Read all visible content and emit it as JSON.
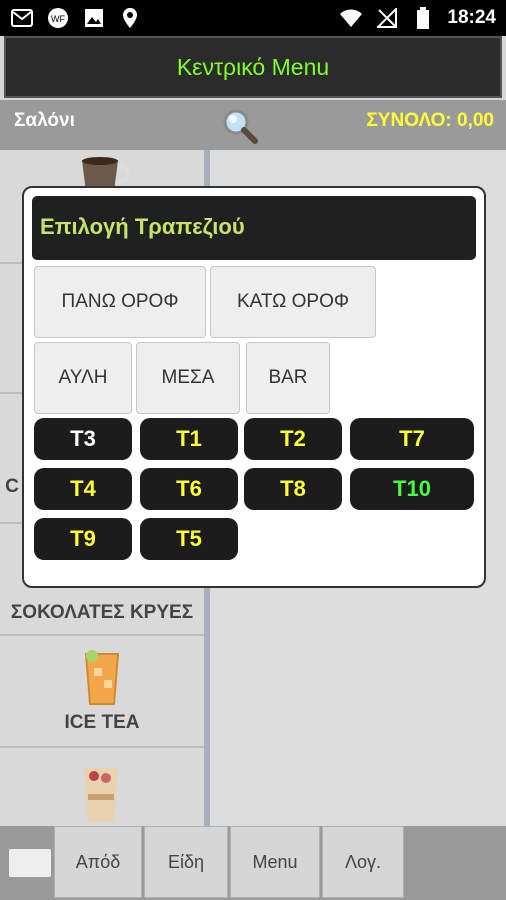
{
  "status_bar": {
    "time": "18:24",
    "icons_left": [
      "gmail-icon",
      "wifi-calling-icon",
      "image-icon",
      "location-icon"
    ],
    "icons_right": [
      "wifi-icon",
      "no-signal-icon",
      "battery-icon"
    ]
  },
  "header": {
    "title": "Κεντρικό Menu"
  },
  "subbar": {
    "room": "Σαλόνι",
    "total": "ΣΥΝΟΛΟ: 0,00"
  },
  "categories": [
    {
      "label": ""
    },
    {
      "label": "C"
    },
    {
      "label": ""
    },
    {
      "label": "ΣΟΚΟΛΑΤΕΣ ΚΡΥΕΣ"
    },
    {
      "label": "ICE TEA"
    },
    {
      "label": ""
    }
  ],
  "bottom_nav": [
    "Απόδ",
    "Είδη",
    "Menu",
    "Λογ."
  ],
  "dialog": {
    "title": "Επιλογή Τραπεζιού",
    "floors": [
      "ΠΑΝΩ ΟΡΟΦ",
      "ΚΑΤΩ ΟΡΟΦ"
    ],
    "areas": [
      "ΑΥΛΗ",
      "ΜΕΣΑ",
      "BAR"
    ],
    "tables": [
      {
        "label": "T3",
        "color": "#ffffff"
      },
      {
        "label": "T1",
        "color": "#ffff33"
      },
      {
        "label": "T2",
        "color": "#ffff33"
      },
      {
        "label": "T7",
        "color": "#ffff33"
      },
      {
        "label": "T4",
        "color": "#ffff33"
      },
      {
        "label": "T6",
        "color": "#ffff33"
      },
      {
        "label": "T8",
        "color": "#ffff33"
      },
      {
        "label": "T10",
        "color": "#44ff44"
      },
      {
        "label": "T9",
        "color": "#ffff33"
      },
      {
        "label": "T5",
        "color": "#ffff33"
      }
    ]
  }
}
